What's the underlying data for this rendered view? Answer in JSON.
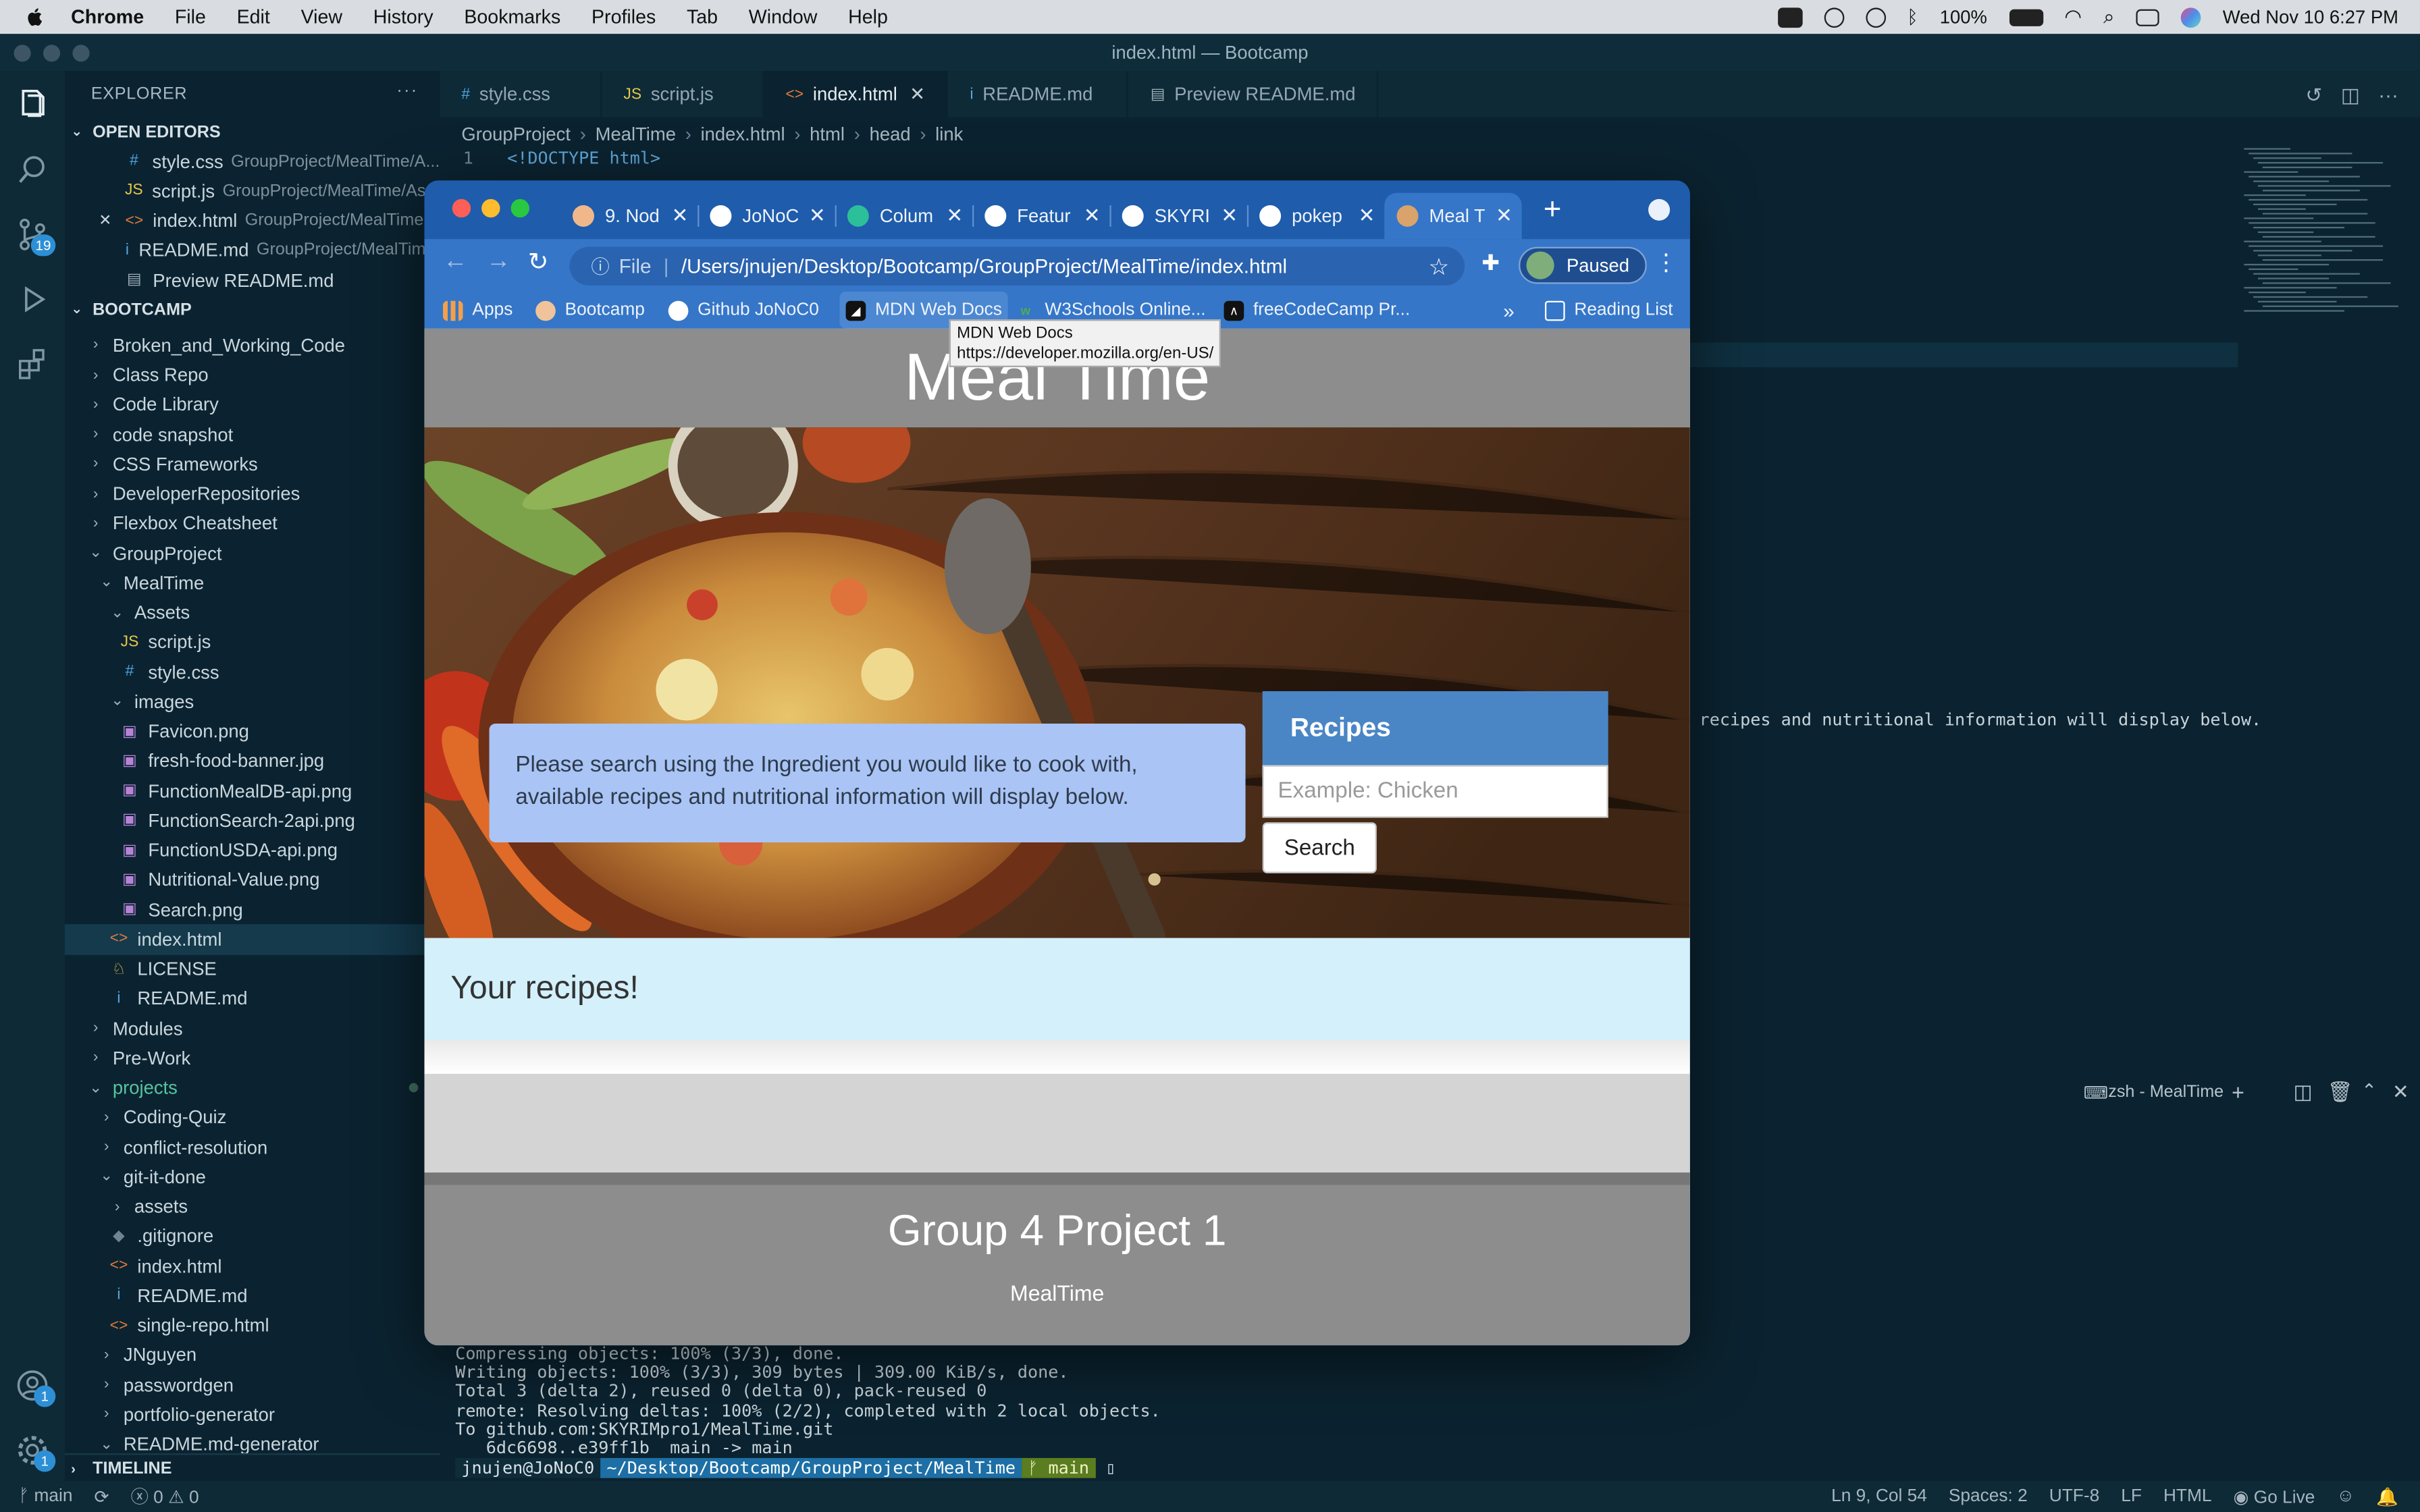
{
  "menubar": {
    "app": "Chrome",
    "items": [
      "File",
      "Edit",
      "View",
      "History",
      "Bookmarks",
      "Profiles",
      "Tab",
      "Window",
      "Help"
    ],
    "battery": "100%",
    "datetime": "Wed Nov 10  6:27 PM"
  },
  "vscode": {
    "window_title": "index.html — Bootcamp",
    "explorer_title": "EXPLORER",
    "open_editors_label": "OPEN EDITORS",
    "open_editors": [
      {
        "icon": "#",
        "name": "style.css",
        "desc": "GroupProject/MealTime/A..."
      },
      {
        "icon": "JS",
        "name": "script.js",
        "desc": "GroupProject/MealTime/As..."
      },
      {
        "icon": "<>",
        "name": "index.html",
        "desc": "GroupProject/MealTime"
      },
      {
        "icon": "i",
        "name": "README.md",
        "desc": "GroupProject/MealTim..."
      },
      {
        "icon": "▤",
        "name": "Preview README.md",
        "desc": ""
      }
    ],
    "workspace_label": "BOOTCAMP",
    "tree": [
      {
        "depth": 0,
        "chev": "›",
        "name": "Broken_and_Working_Code"
      },
      {
        "depth": 0,
        "chev": "›",
        "name": "Class Repo"
      },
      {
        "depth": 0,
        "chev": "›",
        "name": "Code Library"
      },
      {
        "depth": 0,
        "chev": "›",
        "name": "code snapshot"
      },
      {
        "depth": 0,
        "chev": "›",
        "name": "CSS Frameworks"
      },
      {
        "depth": 0,
        "chev": "›",
        "name": "DeveloperRepositories"
      },
      {
        "depth": 0,
        "chev": "›",
        "name": "Flexbox Cheatsheet"
      },
      {
        "depth": 0,
        "chev": "⌄",
        "name": "GroupProject"
      },
      {
        "depth": 1,
        "chev": "⌄",
        "name": "MealTime"
      },
      {
        "depth": 2,
        "chev": "⌄",
        "name": "Assets"
      },
      {
        "depth": 3,
        "chev": "",
        "icon": "JS",
        "name": "script.js"
      },
      {
        "depth": 3,
        "chev": "",
        "icon": "#",
        "name": "style.css"
      },
      {
        "depth": 2,
        "chev": "⌄",
        "name": "images"
      },
      {
        "depth": 3,
        "chev": "",
        "icon": "▣",
        "name": "Favicon.png"
      },
      {
        "depth": 3,
        "chev": "",
        "icon": "▣",
        "name": "fresh-food-banner.jpg"
      },
      {
        "depth": 3,
        "chev": "",
        "icon": "▣",
        "name": "FunctionMealDB-api.png"
      },
      {
        "depth": 3,
        "chev": "",
        "icon": "▣",
        "name": "FunctionSearch-2api.png"
      },
      {
        "depth": 3,
        "chev": "",
        "icon": "▣",
        "name": "FunctionUSDA-api.png"
      },
      {
        "depth": 3,
        "chev": "",
        "icon": "▣",
        "name": "Nutritional-Value.png"
      },
      {
        "depth": 3,
        "chev": "",
        "icon": "▣",
        "name": "Search.png"
      },
      {
        "depth": 2,
        "chev": "",
        "icon": "<>",
        "name": "index.html",
        "selected": true
      },
      {
        "depth": 2,
        "chev": "",
        "icon": "♘",
        "name": "LICENSE"
      },
      {
        "depth": 2,
        "chev": "",
        "icon": "i",
        "name": "README.md"
      },
      {
        "depth": 0,
        "chev": "›",
        "name": "Modules"
      },
      {
        "depth": 0,
        "chev": "›",
        "name": "Pre-Work"
      },
      {
        "depth": 0,
        "chev": "⌄",
        "name": "projects",
        "proj": true
      },
      {
        "depth": 1,
        "chev": "›",
        "name": "Coding-Quiz"
      },
      {
        "depth": 1,
        "chev": "›",
        "name": "conflict-resolution"
      },
      {
        "depth": 1,
        "chev": "⌄",
        "name": "git-it-done"
      },
      {
        "depth": 2,
        "chev": "›",
        "name": "assets"
      },
      {
        "depth": 2,
        "chev": "",
        "icon": "◆",
        "name": ".gitignore"
      },
      {
        "depth": 2,
        "chev": "",
        "icon": "<>",
        "name": "index.html"
      },
      {
        "depth": 2,
        "chev": "",
        "icon": "i",
        "name": "README.md"
      },
      {
        "depth": 2,
        "chev": "",
        "icon": "<>",
        "name": "single-repo.html"
      },
      {
        "depth": 1,
        "chev": "›",
        "name": "JNguyen"
      },
      {
        "depth": 1,
        "chev": "›",
        "name": "passwordgen"
      },
      {
        "depth": 1,
        "chev": "›",
        "name": "portfolio-generator"
      },
      {
        "depth": 1,
        "chev": "⌄",
        "name": "README.md-generator"
      }
    ],
    "timeline_label": "TIMELINE",
    "tabs": [
      {
        "icon": "#",
        "label": "style.css"
      },
      {
        "icon": "JS",
        "label": "script.js"
      },
      {
        "icon": "<>",
        "label": "index.html",
        "active": true
      },
      {
        "icon": "i",
        "label": "README.md"
      },
      {
        "icon": "▤",
        "label": "Preview README.md"
      }
    ],
    "breadcrumbs": [
      "GroupProject",
      "MealTime",
      "index.html",
      "html",
      "head",
      "link"
    ],
    "code_line_number": "1",
    "code_line_text": "<!DOCTYPE html>",
    "code_tail": "recipes and nutritional information will display below.",
    "terminal_name": "zsh - MealTime",
    "terminal_lines": [
      "Compressing objects: 100% (3/3), done.",
      "Writing objects: 100% (3/3), 309 bytes | 309.00 KiB/s, done.",
      "Total 3 (delta 2), reused 0 (delta 0), pack-reused 0",
      "remote: Resolving deltas: 100% (2/2), completed with 2 local objects.",
      "To github.com:SKYRIMpro1/MealTime.git",
      "   6dc6698..e39ff1b  main -> main"
    ],
    "prompt_user": "jnujen@JoNoC0",
    "prompt_path": "~/Desktop/Bootcamp/GroupProject/MealTime",
    "prompt_branch": "ᚠ main",
    "activity_badges": {
      "scm": "19",
      "accounts": "1",
      "settings": "1"
    },
    "status": {
      "branch": "main",
      "problems": "0",
      "warnings": "0",
      "position": "Ln 9, Col 54",
      "spaces": "Spaces: 2",
      "encoding": "UTF-8",
      "eol": "LF",
      "language": "HTML",
      "golive": "Go Live"
    }
  },
  "chrome": {
    "tabs": [
      {
        "label": "9. Nod",
        "fav": "#f0b88a"
      },
      {
        "label": "JoNoC",
        "fav": "#ffffff"
      },
      {
        "label": "Colum",
        "fav": "#2bbf9a"
      },
      {
        "label": "Featur",
        "fav": "#ffffff"
      },
      {
        "label": "SKYRI",
        "fav": "#ffffff"
      },
      {
        "label": "pokep",
        "fav": "#ffffff"
      },
      {
        "label": "Meal T",
        "fav": "#d9a36b",
        "active": true
      }
    ],
    "file_label": "File",
    "url": "/Users/jnujen/Desktop/Bootcamp/GroupProject/MealTime/index.html",
    "profile_status": "Paused",
    "bookmarks": [
      "Apps",
      "Bootcamp",
      "Github JoNoC0",
      "MDN Web Docs",
      "W3Schools Online...",
      "freeCodeCamp Pr..."
    ],
    "bookmarks_overflow": "»",
    "reading_list": "Reading List",
    "tooltip_title": "MDN Web Docs",
    "tooltip_url": "https://developer.mozilla.org/en-US/"
  },
  "page": {
    "site_title": "Meal Time",
    "info_text": "Please search using the Ingredient you would like to cook with, available recipes and nutritional information will display below.",
    "recipes_heading": "Recipes",
    "search_placeholder": "Example: Chicken",
    "search_button": "Search",
    "results_heading": "Your recipes!",
    "footer_title": "Group 4 Project 1",
    "footer_sub": "MealTime"
  }
}
